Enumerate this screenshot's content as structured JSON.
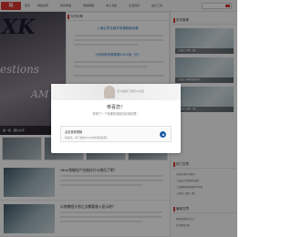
{
  "nav": {
    "logo": "站",
    "items": [
      "首页",
      "网络资源",
      "软件教程",
      "网络教程",
      "电子书籍",
      "生活百科",
      "站长工具"
    ]
  },
  "banner": {
    "words": [
      "XK",
      "estions",
      "AM"
    ],
    "caption": "第一篇 · 图片文字"
  },
  "rec_panel": {
    "heading": "今日头条",
    "titles": [
      "上海云学文献开放课程秘诀最",
      "上传网络资源视频2021版（五）"
    ]
  },
  "sidebar": {
    "heading1": "好文推荐",
    "thumb_captions": [
      "上海线上课程（图）",
      "上海线上网络资源共享",
      "上海线上课程（精）"
    ],
    "heading2": "热门文章",
    "heading3": "最新文章",
    "items": [
      "怎样收到好评推荐？",
      "上海云学文献开放课程",
      "上海网络资源视频2021版",
      "上海线上课程（图）",
      "网络资源共享方法",
      "软件教程合集"
    ]
  },
  "articles": [
    {
      "title": "Html领域在产业链在什么地位了呢？"
    },
    {
      "title": "以前教程计划之点都要装入显示的？"
    },
    {
      "title": "以教规则计的之全部要装入显示的？"
    }
  ],
  "modal": {
    "image_tag": "怎么收到了我怎么点击",
    "title": "恭喜您！",
    "subtitle": "获得了一个有趣的我座的阅读权限！",
    "reward_name": "点击查看视频",
    "reward_desc": "恭喜您，得了我的24小时的阅读权限！"
  },
  "colors": {
    "accent": "#d9362f",
    "link": "#1e6fb8",
    "reward_icon": "#1f5fa8"
  }
}
